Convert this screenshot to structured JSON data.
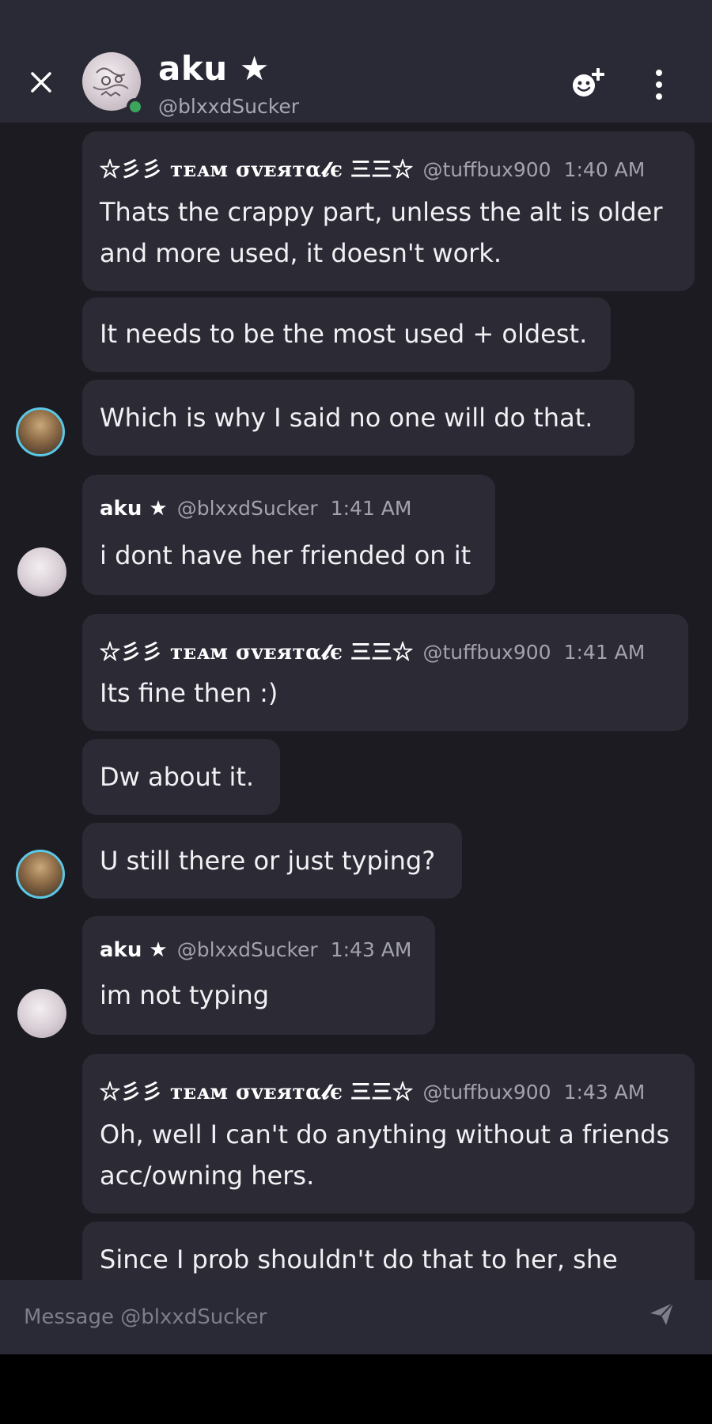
{
  "header": {
    "name": "aku ★",
    "handle": "@blxxdSucker"
  },
  "messages": {
    "g1": {
      "author": "☆彡彡 ᴛᴇᴀᴍ σᴠᴇяᴛα𝓵є 三三☆",
      "handle": "@tuffbux900",
      "time": "1:40 AM",
      "text1": "Thats the crappy part, unless the alt is older and more used, it doesn't work.",
      "text2": "It needs to be the most used + oldest.",
      "text3": "Which is why I said no one will do that."
    },
    "g2": {
      "author": "aku ★",
      "handle": "@blxxdSucker",
      "time": "1:41 AM",
      "text1": "i dont have her friended on it"
    },
    "g3": {
      "author": "☆彡彡 ᴛᴇᴀᴍ σᴠᴇяᴛα𝓵є 三三☆",
      "handle": "@tuffbux900",
      "time": "1:41 AM",
      "text1": "Its fine then :)",
      "text2": "Dw about it.",
      "text3": "U still there or just typing?"
    },
    "g4": {
      "author": "aku ★",
      "handle": "@blxxdSucker",
      "time": "1:43 AM",
      "text1": "im not typing"
    },
    "g5": {
      "author": "☆彡彡 ᴛᴇᴀᴍ σᴠᴇяᴛα𝓵є 三三☆",
      "handle": "@tuffbux900",
      "time": "1:43 AM",
      "text1": "Oh, well I can't do anything without a friends acc/owning hers.",
      "text2": "Since I prob shouldn't do that to her, she"
    }
  },
  "composer": {
    "placeholder": "Message @blxxdSucker"
  },
  "colors": {
    "background": "#1c1b22",
    "header": "#2a2a36",
    "bubble": "#2b2a35",
    "online": "#3ba55c",
    "avatar_ring": "#5bc8e6"
  },
  "icons": [
    "close-icon",
    "add-friend-icon",
    "more-vertical-icon",
    "send-icon"
  ]
}
